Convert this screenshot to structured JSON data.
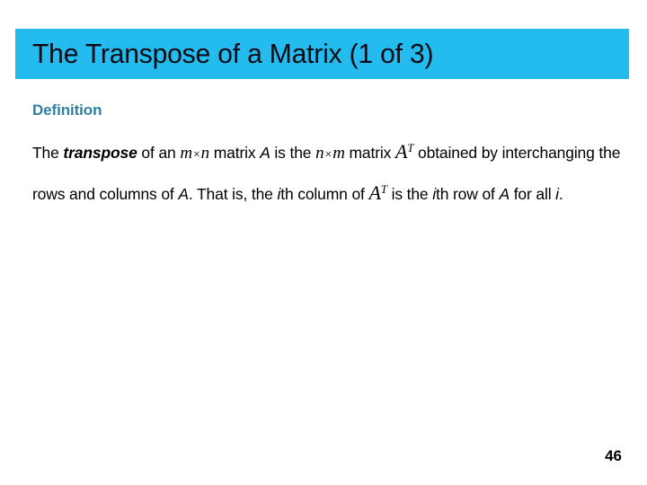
{
  "slide": {
    "title": "The Transpose of a Matrix (1 of 3)",
    "title_bar_color": "#24bcef",
    "background_color": "#ffffff",
    "page_number": "46"
  },
  "content": {
    "heading": "Definition",
    "heading_color": "#2e7fa0",
    "paragraph_plain": "The transpose of an m × n matrix A is the n × m matrix A^T obtained by interchanging the rows and columns of A. That is, the ith column of A^T is the ith row of A for all i.",
    "tokens": {
      "t1": "The ",
      "t2": "transpose",
      "t3": " of an ",
      "m1": "m",
      "x1": "×",
      "n1": "n",
      "t4": " matrix ",
      "a1": "A",
      "t5": " is the ",
      "n2": "n",
      "x2": "×",
      "m2": "m",
      "t6": " matrix ",
      "a2": "A",
      "sup1": "T",
      "t7": " obtained by interchanging the rows and columns of ",
      "a3": "A",
      "t8": ". That is, the ",
      "i1": "i",
      "t9": "th column of ",
      "a4": "A",
      "sup2": "T",
      "t10": " is the ",
      "i2": "i",
      "t11": "th row of ",
      "a5": "A",
      "t12": " for all ",
      "i3": "i",
      "t13": "."
    }
  }
}
